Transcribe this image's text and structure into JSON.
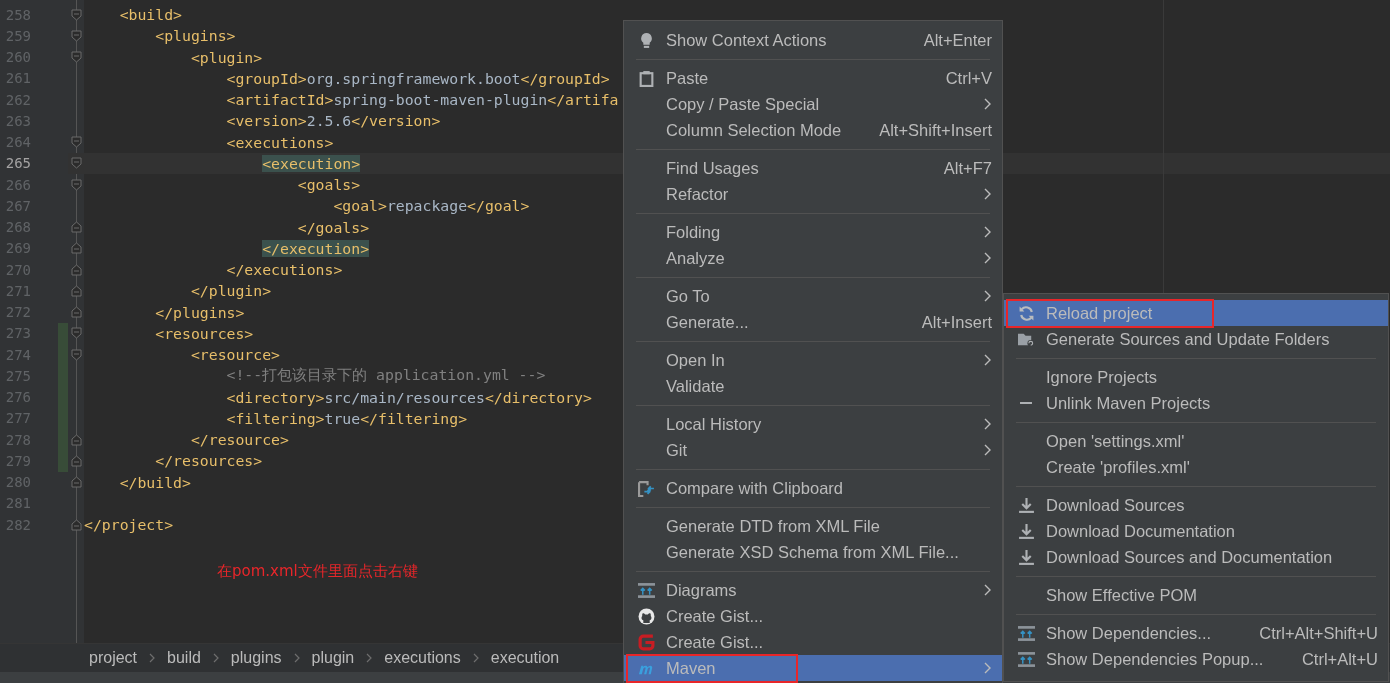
{
  "editor": {
    "lines": [
      {
        "number": "258",
        "fold_start": true,
        "fold_end": false,
        "current": false,
        "changed": false,
        "tokens": [
          {
            "kind": "tag",
            "text": "    <build>"
          }
        ]
      },
      {
        "number": "259",
        "fold_start": true,
        "fold_end": false,
        "current": false,
        "changed": false,
        "tokens": [
          {
            "kind": "tag",
            "text": "        <plugins>"
          }
        ]
      },
      {
        "number": "260",
        "fold_start": true,
        "fold_end": false,
        "current": false,
        "changed": false,
        "tokens": [
          {
            "kind": "tag",
            "text": "            <plugin>"
          }
        ]
      },
      {
        "number": "261",
        "fold_start": false,
        "fold_end": false,
        "current": false,
        "changed": false,
        "tokens": [
          {
            "kind": "tag",
            "text": "                <groupId>"
          },
          {
            "kind": "value",
            "text": "org.springframework.boot"
          },
          {
            "kind": "tag",
            "text": "</groupId>"
          }
        ]
      },
      {
        "number": "262",
        "fold_start": false,
        "fold_end": false,
        "current": false,
        "changed": false,
        "tokens": [
          {
            "kind": "tag",
            "text": "                <artifactId>"
          },
          {
            "kind": "value",
            "text": "spring-boot-maven-plugin"
          },
          {
            "kind": "tag",
            "text": "</artifa"
          }
        ]
      },
      {
        "number": "263",
        "fold_start": false,
        "fold_end": false,
        "current": false,
        "changed": false,
        "tokens": [
          {
            "kind": "tag",
            "text": "                <version>"
          },
          {
            "kind": "value",
            "text": "2.5.6"
          },
          {
            "kind": "tag",
            "text": "</version>"
          }
        ]
      },
      {
        "number": "264",
        "fold_start": true,
        "fold_end": false,
        "current": false,
        "changed": false,
        "tokens": [
          {
            "kind": "tag",
            "text": "                <executions>"
          }
        ]
      },
      {
        "number": "265",
        "fold_start": true,
        "fold_end": false,
        "current": true,
        "changed": false,
        "tokens": [
          {
            "kind": "tag-match",
            "text": "                    <execution>"
          }
        ]
      },
      {
        "number": "266",
        "fold_start": true,
        "fold_end": false,
        "current": false,
        "changed": false,
        "tokens": [
          {
            "kind": "tag",
            "text": "                        <goals>"
          }
        ]
      },
      {
        "number": "267",
        "fold_start": false,
        "fold_end": false,
        "current": false,
        "changed": false,
        "tokens": [
          {
            "kind": "tag",
            "text": "                            <goal>"
          },
          {
            "kind": "value",
            "text": "repackage"
          },
          {
            "kind": "tag",
            "text": "</goal>"
          }
        ]
      },
      {
        "number": "268",
        "fold_start": false,
        "fold_end": true,
        "current": false,
        "changed": false,
        "tokens": [
          {
            "kind": "tag",
            "text": "                        </goals>"
          }
        ]
      },
      {
        "number": "269",
        "fold_start": false,
        "fold_end": true,
        "current": false,
        "changed": false,
        "tokens": [
          {
            "kind": "tag-match",
            "text": "                    </execution>"
          }
        ]
      },
      {
        "number": "270",
        "fold_start": false,
        "fold_end": true,
        "current": false,
        "changed": false,
        "tokens": [
          {
            "kind": "tag",
            "text": "                </executions>"
          }
        ]
      },
      {
        "number": "271",
        "fold_start": false,
        "fold_end": true,
        "current": false,
        "changed": false,
        "tokens": [
          {
            "kind": "tag",
            "text": "            </plugin>"
          }
        ]
      },
      {
        "number": "272",
        "fold_start": false,
        "fold_end": true,
        "current": false,
        "changed": false,
        "tokens": [
          {
            "kind": "tag",
            "text": "        </plugins>"
          }
        ]
      },
      {
        "number": "273",
        "fold_start": true,
        "fold_end": false,
        "current": false,
        "changed": true,
        "tokens": [
          {
            "kind": "tag",
            "text": "        <resources>"
          }
        ]
      },
      {
        "number": "274",
        "fold_start": true,
        "fold_end": false,
        "current": false,
        "changed": true,
        "tokens": [
          {
            "kind": "tag",
            "text": "            <resource>"
          }
        ]
      },
      {
        "number": "275",
        "fold_start": false,
        "fold_end": false,
        "current": false,
        "changed": true,
        "tokens": [
          {
            "kind": "comment",
            "text": "                <!--打包该目录下的 application.yml -->"
          }
        ]
      },
      {
        "number": "276",
        "fold_start": false,
        "fold_end": false,
        "current": false,
        "changed": true,
        "tokens": [
          {
            "kind": "tag",
            "text": "                <directory>"
          },
          {
            "kind": "value",
            "text": "src/main/resources"
          },
          {
            "kind": "tag",
            "text": "</directory>"
          }
        ]
      },
      {
        "number": "277",
        "fold_start": false,
        "fold_end": false,
        "current": false,
        "changed": true,
        "tokens": [
          {
            "kind": "tag",
            "text": "                <filtering>"
          },
          {
            "kind": "value",
            "text": "true"
          },
          {
            "kind": "tag",
            "text": "</filtering>"
          }
        ]
      },
      {
        "number": "278",
        "fold_start": false,
        "fold_end": true,
        "current": false,
        "changed": true,
        "tokens": [
          {
            "kind": "tag",
            "text": "            </resource>"
          }
        ]
      },
      {
        "number": "279",
        "fold_start": false,
        "fold_end": true,
        "current": false,
        "changed": true,
        "tokens": [
          {
            "kind": "tag",
            "text": "        </resources>"
          }
        ]
      },
      {
        "number": "280",
        "fold_start": false,
        "fold_end": true,
        "current": false,
        "changed": false,
        "tokens": [
          {
            "kind": "tag",
            "text": "    </build>"
          }
        ]
      },
      {
        "number": "281",
        "fold_start": false,
        "fold_end": false,
        "current": false,
        "changed": false
      },
      {
        "number": "282",
        "fold_start": false,
        "fold_end": true,
        "current": false,
        "changed": false,
        "tokens": [
          {
            "kind": "tag",
            "text": "</project>"
          }
        ]
      }
    ],
    "annotation": "在pom.xml文件里面点击右键"
  },
  "breadcrumbs": [
    "project",
    "build",
    "plugins",
    "plugin",
    "executions",
    "execution"
  ],
  "context_menu": {
    "items": [
      {
        "kind": "action",
        "label": "Show Context Actions",
        "shortcut": "Alt+Enter",
        "submenu": false,
        "selected": false,
        "annotated": false
      },
      {
        "kind": "separator"
      },
      {
        "kind": "action",
        "label": "Paste",
        "shortcut": "Ctrl+V",
        "submenu": false,
        "selected": false,
        "annotated": false
      },
      {
        "kind": "action",
        "label": "Copy / Paste Special",
        "submenu": true,
        "selected": false,
        "annotated": false
      },
      {
        "kind": "action",
        "label": "Column Selection Mode",
        "shortcut": "Alt+Shift+Insert",
        "submenu": false,
        "selected": false,
        "annotated": false
      },
      {
        "kind": "separator"
      },
      {
        "kind": "action",
        "label": "Find Usages",
        "shortcut": "Alt+F7",
        "submenu": false,
        "selected": false,
        "annotated": false
      },
      {
        "kind": "action",
        "label": "Refactor",
        "submenu": true,
        "selected": false,
        "annotated": false
      },
      {
        "kind": "separator"
      },
      {
        "kind": "action",
        "label": "Folding",
        "submenu": true,
        "selected": false,
        "annotated": false
      },
      {
        "kind": "action",
        "label": "Analyze",
        "submenu": true,
        "selected": false,
        "annotated": false
      },
      {
        "kind": "separator"
      },
      {
        "kind": "action",
        "label": "Go To",
        "submenu": true,
        "selected": false,
        "annotated": false
      },
      {
        "kind": "action",
        "label": "Generate...",
        "shortcut": "Alt+Insert",
        "submenu": false,
        "selected": false,
        "annotated": false
      },
      {
        "kind": "separator"
      },
      {
        "kind": "action",
        "label": "Open In",
        "submenu": true,
        "selected": false,
        "annotated": false
      },
      {
        "kind": "action",
        "label": "Validate",
        "submenu": false,
        "selected": false,
        "annotated": false
      },
      {
        "kind": "separator"
      },
      {
        "kind": "action",
        "label": "Local History",
        "submenu": true,
        "selected": false,
        "annotated": false
      },
      {
        "kind": "action",
        "label": "Git",
        "submenu": true,
        "selected": false,
        "annotated": false
      },
      {
        "kind": "separator"
      },
      {
        "kind": "action",
        "label": "Compare with Clipboard",
        "submenu": false,
        "selected": false,
        "annotated": false
      },
      {
        "kind": "separator"
      },
      {
        "kind": "action",
        "label": "Generate DTD from XML File",
        "submenu": false,
        "selected": false,
        "annotated": false
      },
      {
        "kind": "action",
        "label": "Generate XSD Schema from XML File...",
        "submenu": false,
        "selected": false,
        "annotated": false
      },
      {
        "kind": "separator"
      },
      {
        "kind": "action",
        "label": "Diagrams",
        "submenu": true,
        "selected": false,
        "annotated": false
      },
      {
        "kind": "action",
        "label": "Create Gist...",
        "submenu": false,
        "selected": false,
        "annotated": false
      },
      {
        "kind": "action",
        "label": "Create Gist...",
        "submenu": false,
        "selected": false,
        "annotated": false
      },
      {
        "kind": "action",
        "label": "Maven",
        "submenu": true,
        "selected": true,
        "annotated": true
      }
    ]
  },
  "maven_submenu": {
    "items": [
      {
        "kind": "action",
        "label": "Reload project",
        "selected": true,
        "annotated": true
      },
      {
        "kind": "action",
        "label": "Generate Sources and Update Folders",
        "selected": false,
        "annotated": false
      },
      {
        "kind": "separator"
      },
      {
        "kind": "action",
        "label": "Ignore Projects",
        "selected": false,
        "annotated": false
      },
      {
        "kind": "action",
        "label": "Unlink Maven Projects",
        "selected": false,
        "annotated": false
      },
      {
        "kind": "separator"
      },
      {
        "kind": "action",
        "label": "Open 'settings.xml'",
        "selected": false,
        "annotated": false
      },
      {
        "kind": "action",
        "label": "Create 'profiles.xml'",
        "selected": false,
        "annotated": false
      },
      {
        "kind": "separator"
      },
      {
        "kind": "action",
        "label": "Download Sources",
        "selected": false,
        "annotated": false
      },
      {
        "kind": "action",
        "label": "Download Documentation",
        "selected": false,
        "annotated": false
      },
      {
        "kind": "action",
        "label": "Download Sources and Documentation",
        "selected": false,
        "annotated": false
      },
      {
        "kind": "separator"
      },
      {
        "kind": "action",
        "label": "Show Effective POM",
        "selected": false,
        "annotated": false
      },
      {
        "kind": "separator"
      },
      {
        "kind": "action",
        "label": "Show Dependencies...",
        "shortcut": "Ctrl+Alt+Shift+U",
        "selected": false,
        "annotated": false
      },
      {
        "kind": "action",
        "label": "Show Dependencies Popup...",
        "shortcut": "Ctrl+Alt+U",
        "selected": false,
        "annotated": false
      }
    ]
  }
}
